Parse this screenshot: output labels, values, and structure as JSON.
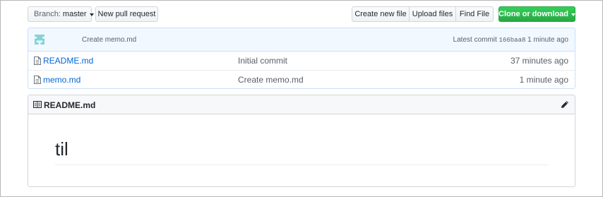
{
  "toolbar": {
    "branch_label": "Branch:",
    "branch_value": "master",
    "new_pull_request": "New pull request",
    "create_new_file": "Create new file",
    "upload_files": "Upload files",
    "find_file": "Find File",
    "clone_or_download": "Clone or download"
  },
  "commit_bar": {
    "message": "Create memo.md",
    "latest_label": "Latest commit",
    "sha": "166baa8",
    "age": "1 minute ago"
  },
  "files": [
    {
      "name": "README.md",
      "message": "Initial commit",
      "age": "37 minutes ago"
    },
    {
      "name": "memo.md",
      "message": "Create memo.md",
      "age": "1 minute ago"
    }
  ],
  "readme": {
    "title": "README.md",
    "heading": "til"
  },
  "colors": {
    "link": "#0366d6",
    "clone_green": "#28a745",
    "commit_bar_bg": "#f1f8ff"
  },
  "icons": [
    "identicon-avatar",
    "file-icon",
    "book-icon",
    "pencil-icon",
    "caret-down-icon"
  ]
}
